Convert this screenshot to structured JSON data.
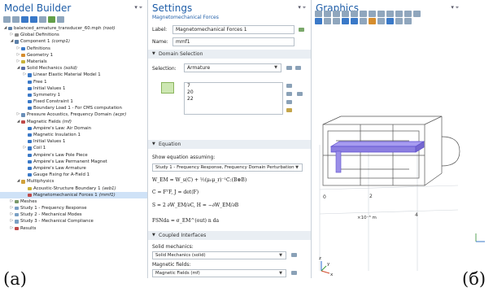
{
  "model_builder": {
    "title": "Model Builder",
    "pin": "▾ ⌖",
    "tree": [
      {
        "label": "balanced_armature_transducer_60.mph",
        "tag": "(root)",
        "lvl": 0,
        "arrow": "◢",
        "icon": "#5b7fa8"
      },
      {
        "label": "Global Definitions",
        "tag": "",
        "lvl": 1,
        "arrow": "▷",
        "icon": "#8c8c8c"
      },
      {
        "label": "Component 1",
        "tag": "(comp1)",
        "lvl": 1,
        "arrow": "◢",
        "icon": "#5b7fa8"
      },
      {
        "label": "Definitions",
        "tag": "",
        "lvl": 2,
        "arrow": "▷",
        "icon": "#3a79c8"
      },
      {
        "label": "Geometry 1",
        "tag": "",
        "lvl": 2,
        "arrow": "▷",
        "icon": "#d68d2e"
      },
      {
        "label": "Materials",
        "tag": "",
        "lvl": 2,
        "arrow": "▷",
        "icon": "#c9b23a"
      },
      {
        "label": "Solid Mechanics",
        "tag": "(solid)",
        "lvl": 2,
        "arrow": "◢",
        "icon": "#5b6fa8"
      },
      {
        "label": "Linear Elastic Material Model 1",
        "tag": "",
        "lvl": 3,
        "arrow": "▷",
        "icon": "#3a79c8"
      },
      {
        "label": "Free 1",
        "tag": "",
        "lvl": 3,
        "arrow": "",
        "icon": "#3a79c8"
      },
      {
        "label": "Initial Values 1",
        "tag": "",
        "lvl": 3,
        "arrow": "",
        "icon": "#3a79c8"
      },
      {
        "label": "Symmetry 1",
        "tag": "",
        "lvl": 3,
        "arrow": "",
        "icon": "#3a79c8"
      },
      {
        "label": "Fixed Constraint 1",
        "tag": "",
        "lvl": 3,
        "arrow": "",
        "icon": "#3a79c8"
      },
      {
        "label": "Boundary Load 1 - For CMS computation",
        "tag": "",
        "lvl": 3,
        "arrow": "",
        "icon": "#3a79c8"
      },
      {
        "label": "Pressure Acoustics, Frequency Domain",
        "tag": "(acpr)",
        "lvl": 2,
        "arrow": "▷",
        "icon": "#6a8fb8"
      },
      {
        "label": "Magnetic Fields",
        "tag": "(mf)",
        "lvl": 2,
        "arrow": "◢",
        "icon": "#c04a4a"
      },
      {
        "label": "Ampère's Law: Air Domain",
        "tag": "",
        "lvl": 3,
        "arrow": "",
        "icon": "#3a79c8"
      },
      {
        "label": "Magnetic Insulation 1",
        "tag": "",
        "lvl": 3,
        "arrow": "",
        "icon": "#3a79c8"
      },
      {
        "label": "Initial Values 1",
        "tag": "",
        "lvl": 3,
        "arrow": "",
        "icon": "#3a79c8"
      },
      {
        "label": "Coil 1",
        "tag": "",
        "lvl": 3,
        "arrow": "▷",
        "icon": "#3a79c8"
      },
      {
        "label": "Ampère's Law Pole Piece",
        "tag": "",
        "lvl": 3,
        "arrow": "",
        "icon": "#3a79c8"
      },
      {
        "label": "Ampère's Law Permanent Magnet",
        "tag": "",
        "lvl": 3,
        "arrow": "",
        "icon": "#3a79c8"
      },
      {
        "label": "Ampère's Law Armature",
        "tag": "",
        "lvl": 3,
        "arrow": "",
        "icon": "#3a79c8"
      },
      {
        "label": "Gauge Fixing for A-Field 1",
        "tag": "",
        "lvl": 3,
        "arrow": "",
        "icon": "#3a79c8"
      },
      {
        "label": "Multiphysics",
        "tag": "",
        "lvl": 2,
        "arrow": "◢",
        "icon": "#d1a23a"
      },
      {
        "label": "Acoustic-Structure Boundary 1",
        "tag": "(asb1)",
        "lvl": 3,
        "arrow": "",
        "icon": "#c9b23a"
      },
      {
        "label": "Magnetomechanical Forces 1",
        "tag": "(mmf1)",
        "lvl": 3,
        "arrow": "",
        "icon": "#c04a4a",
        "selected": true
      },
      {
        "label": "Meshes",
        "tag": "",
        "lvl": 1,
        "arrow": "▷",
        "icon": "#7a9a6a"
      },
      {
        "label": "Study 1 - Frequency Response",
        "tag": "",
        "lvl": 1,
        "arrow": "▷",
        "icon": "#7aa0c4"
      },
      {
        "label": "Study 2 - Mechanical Modes",
        "tag": "",
        "lvl": 1,
        "arrow": "▷",
        "icon": "#7aa0c4"
      },
      {
        "label": "Study 3 - Mechanical Compliance",
        "tag": "",
        "lvl": 1,
        "arrow": "▷",
        "icon": "#7aa0c4"
      },
      {
        "label": "Results",
        "tag": "",
        "lvl": 1,
        "arrow": "▷",
        "icon": "#c04a4a"
      }
    ]
  },
  "settings": {
    "title": "Settings",
    "subtitle": "Magnetomechanical Forces",
    "label_caption": "Label:",
    "label_value": "Magnetomechanical Forces 1",
    "name_caption": "Name:",
    "name_value": "mmf1",
    "domain_section": "Domain Selection",
    "selection_caption": "Selection:",
    "selection_value": "Armature",
    "domains": [
      "7",
      "20",
      "22"
    ],
    "equation_section": "Equation",
    "show_eq_caption": "Show equation assuming:",
    "show_eq_value": "Study 1 - Frequency Response, Frequency Domain Perturbation",
    "eq1": "W_EM = W_s(C) + ½(μ₀μ_r)⁻¹C:(B⊗B)",
    "eq2": "C = FᵀF,   J = det(F)",
    "eq3": "S = 2 ∂W_EM/∂C,   H = −∂W_EM/∂B",
    "eq4": "FSNda = σ_EM^(out) n da",
    "coupled_section": "Coupled Interfaces",
    "solid_caption": "Solid mechanics:",
    "solid_value": "Solid Mechanics (solid)",
    "mag_caption": "Magnetic fields:",
    "mag_value": "Magnetic Fields (mf)"
  },
  "graphics": {
    "title": "Graphics",
    "axis_ticks": [
      "0",
      "2",
      "4"
    ],
    "axis_unit": "×10⁻³ m",
    "triad": [
      "z",
      "y",
      "x"
    ]
  },
  "labels": {
    "a": "(a)",
    "b": "(б)"
  },
  "colors": {
    "accent": "#1f5ea8",
    "selection": "#cfe2f7",
    "armature": "#8c7fe0"
  }
}
